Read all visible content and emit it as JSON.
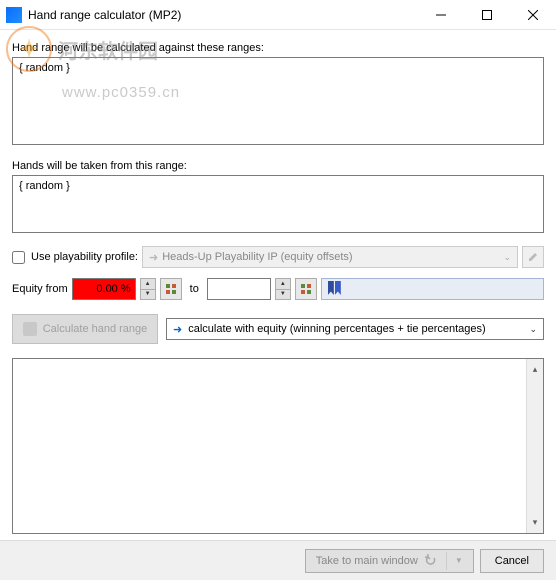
{
  "window": {
    "title": "Hand range calculator (MP2)"
  },
  "watermark": {
    "text1": "河东软件园",
    "text2": "www.pc0359.cn"
  },
  "labels": {
    "against": "Hand range will be calculated against these ranges:",
    "taken_from": "Hands will be taken from this range:",
    "use_profile": "Use playability profile:",
    "equity_from": "Equity from",
    "to": "to"
  },
  "inputs": {
    "against_ranges": "{ random }",
    "taken_from_range": "{ random }",
    "profile_value": "Heads-Up Playability IP  (equity offsets)",
    "equity_from": "0.00 %",
    "equity_to": ""
  },
  "buttons": {
    "calculate": "Calculate hand range",
    "calc_mode": "calculate with equity (winning percentages + tie percentages)",
    "take_main": "Take to main window",
    "cancel": "Cancel"
  }
}
